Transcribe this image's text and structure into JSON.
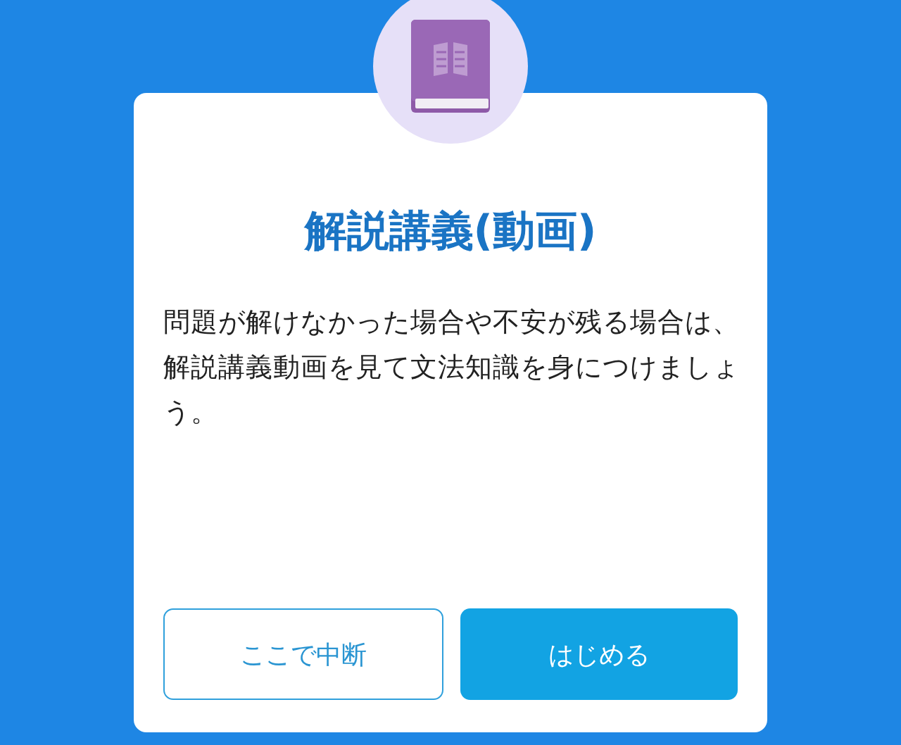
{
  "dialog": {
    "title": "解説講義(動画)",
    "message": "問題が解けなかった場合や不安が残る場合は、解説講義動画を見て文法知識を身につけましょう。",
    "buttons": [
      {
        "label": "ここで中断",
        "kind": "secondary"
      },
      {
        "label": "はじめる",
        "kind": "primary"
      }
    ]
  }
}
